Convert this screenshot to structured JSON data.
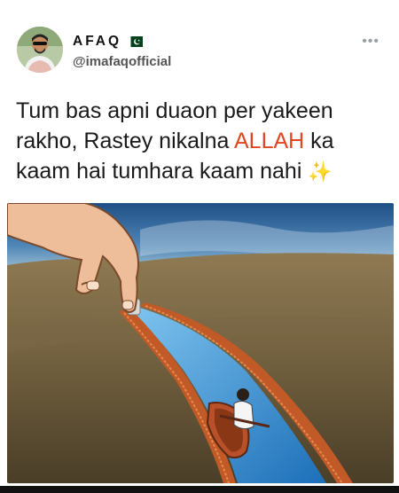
{
  "author": {
    "display_name": "AFAQ",
    "handle": "@imafaqofficial",
    "flag_icon": "pakistan-flag-icon",
    "more_icon": "more-options-icon"
  },
  "tweet": {
    "text_before": "Tum bas apni duaon per yakeen rakho, Rastey nikalna ",
    "text_highlight": "ALLAH",
    "text_after": " ka kaam hai tumhara kaam nahi",
    "emoji": "✨",
    "highlight_color": "#e0461f"
  },
  "media": {
    "type": "illustration",
    "subject": "hand-unzipping-river-with-boat"
  }
}
